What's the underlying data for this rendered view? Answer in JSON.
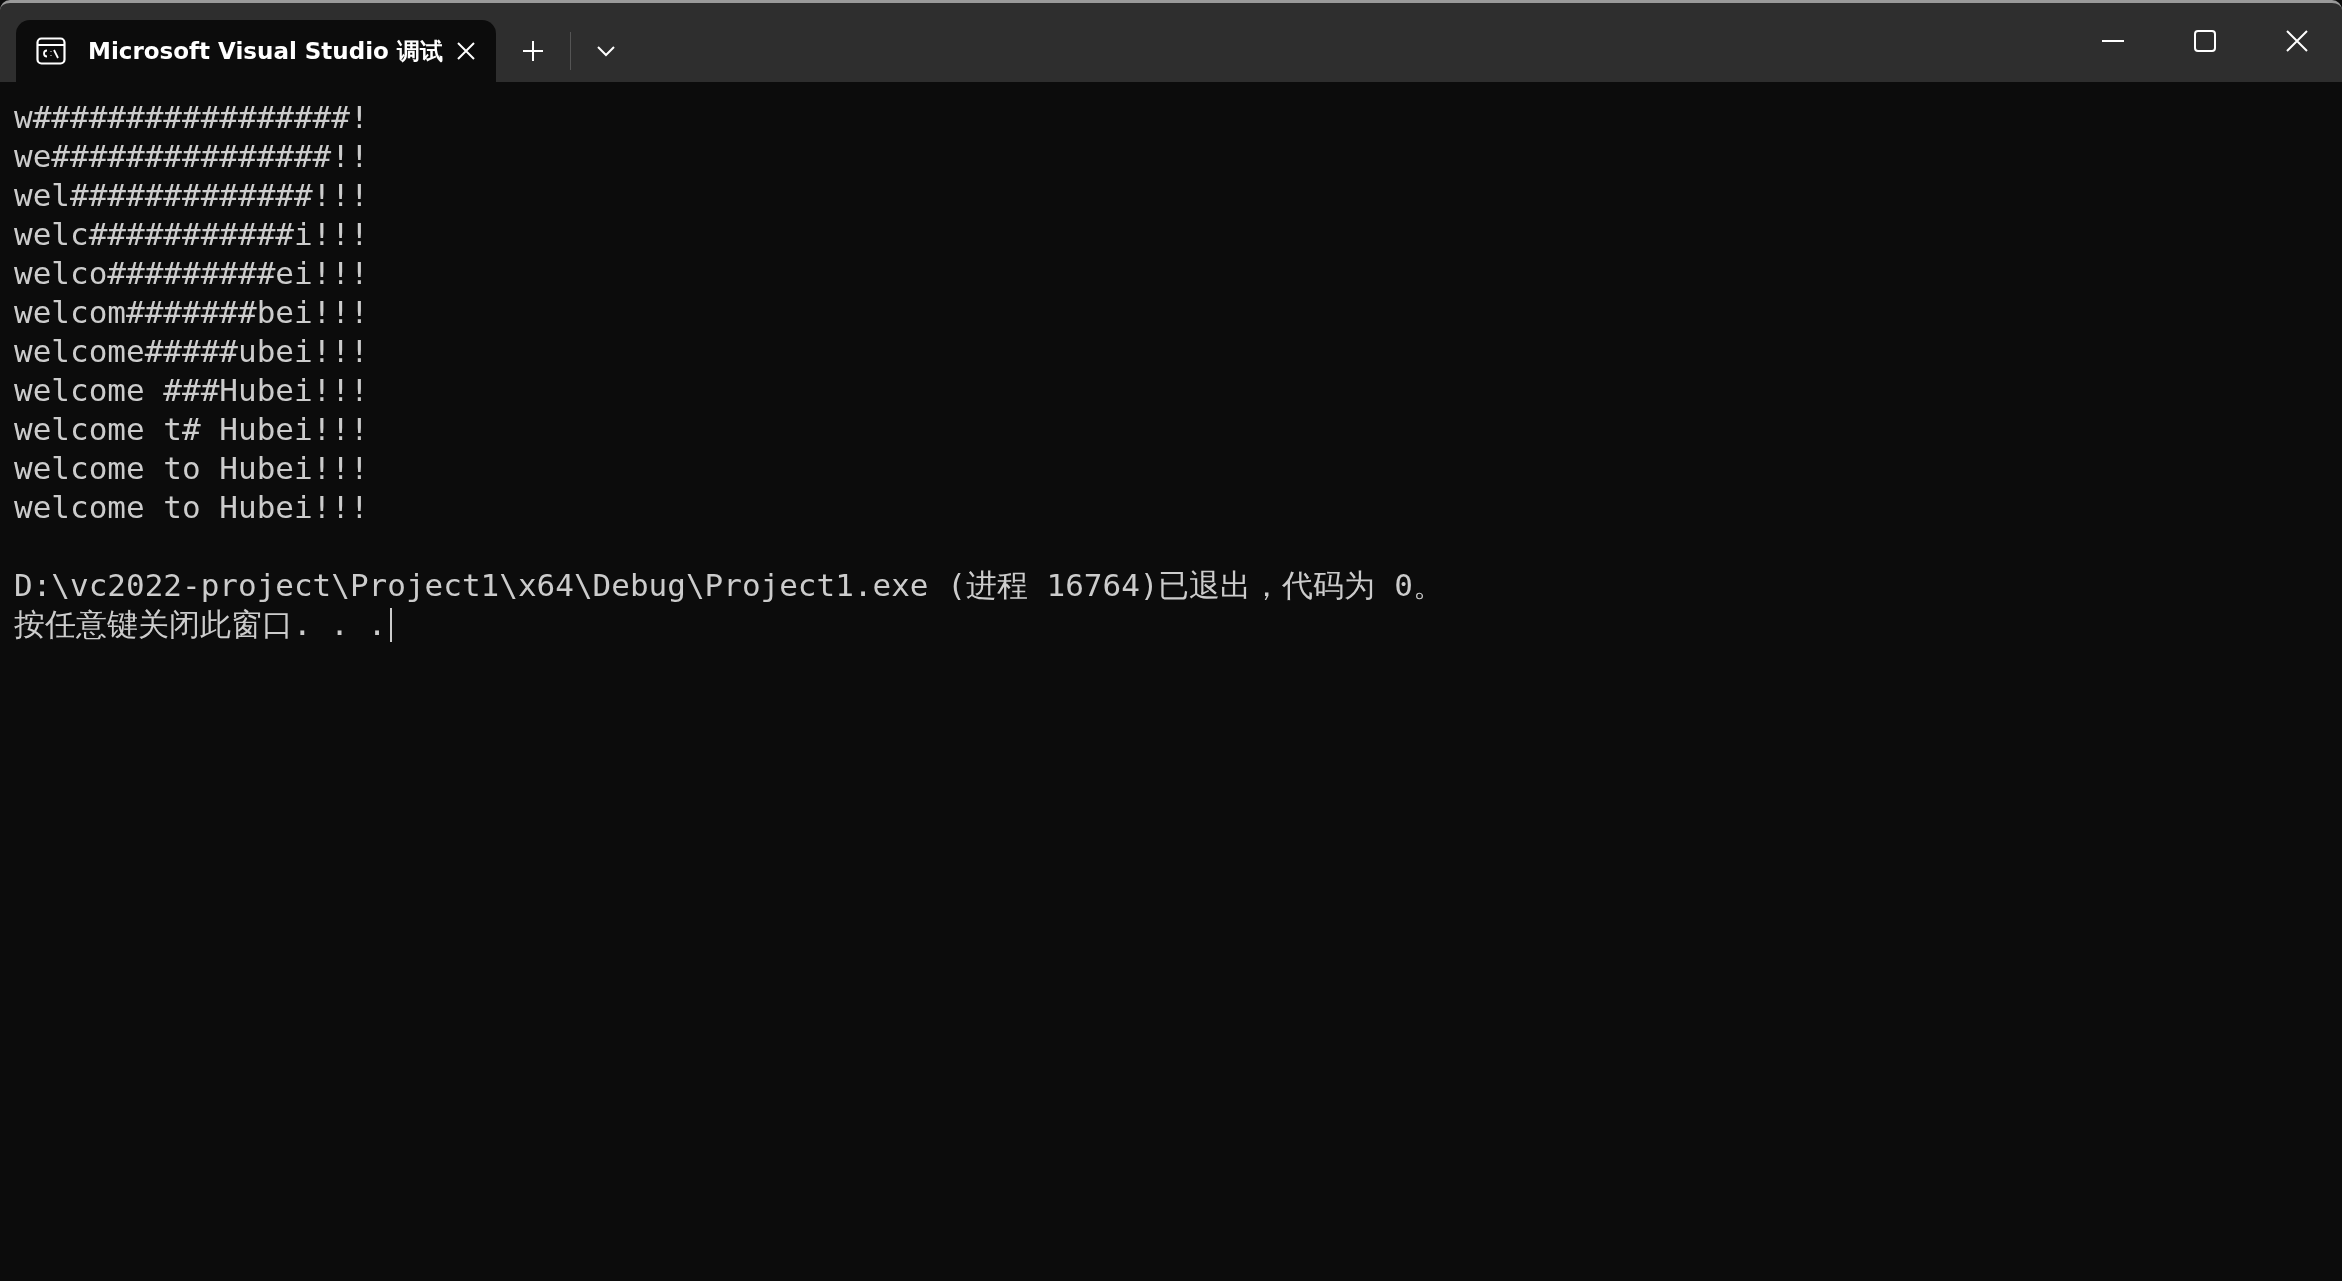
{
  "tabs": [
    {
      "title": "Microsoft Visual Studio 调试",
      "selected": true
    }
  ],
  "console": {
    "output": [
      "w#################!",
      "we###############!!",
      "wel#############!!!",
      "welc###########i!!!",
      "welco#########ei!!!",
      "welcom#######bei!!!",
      "welcome#####ubei!!!",
      "welcome ###Hubei!!!",
      "welcome t# Hubei!!!",
      "welcome to Hubei!!!",
      "welcome to Hubei!!!"
    ],
    "exit_message": [
      "D:\\vc2022-project\\Project1\\x64\\Debug\\Project1.exe (进程 16764)已退出，代码为 0。",
      "按任意键关闭此窗口. . ."
    ]
  }
}
